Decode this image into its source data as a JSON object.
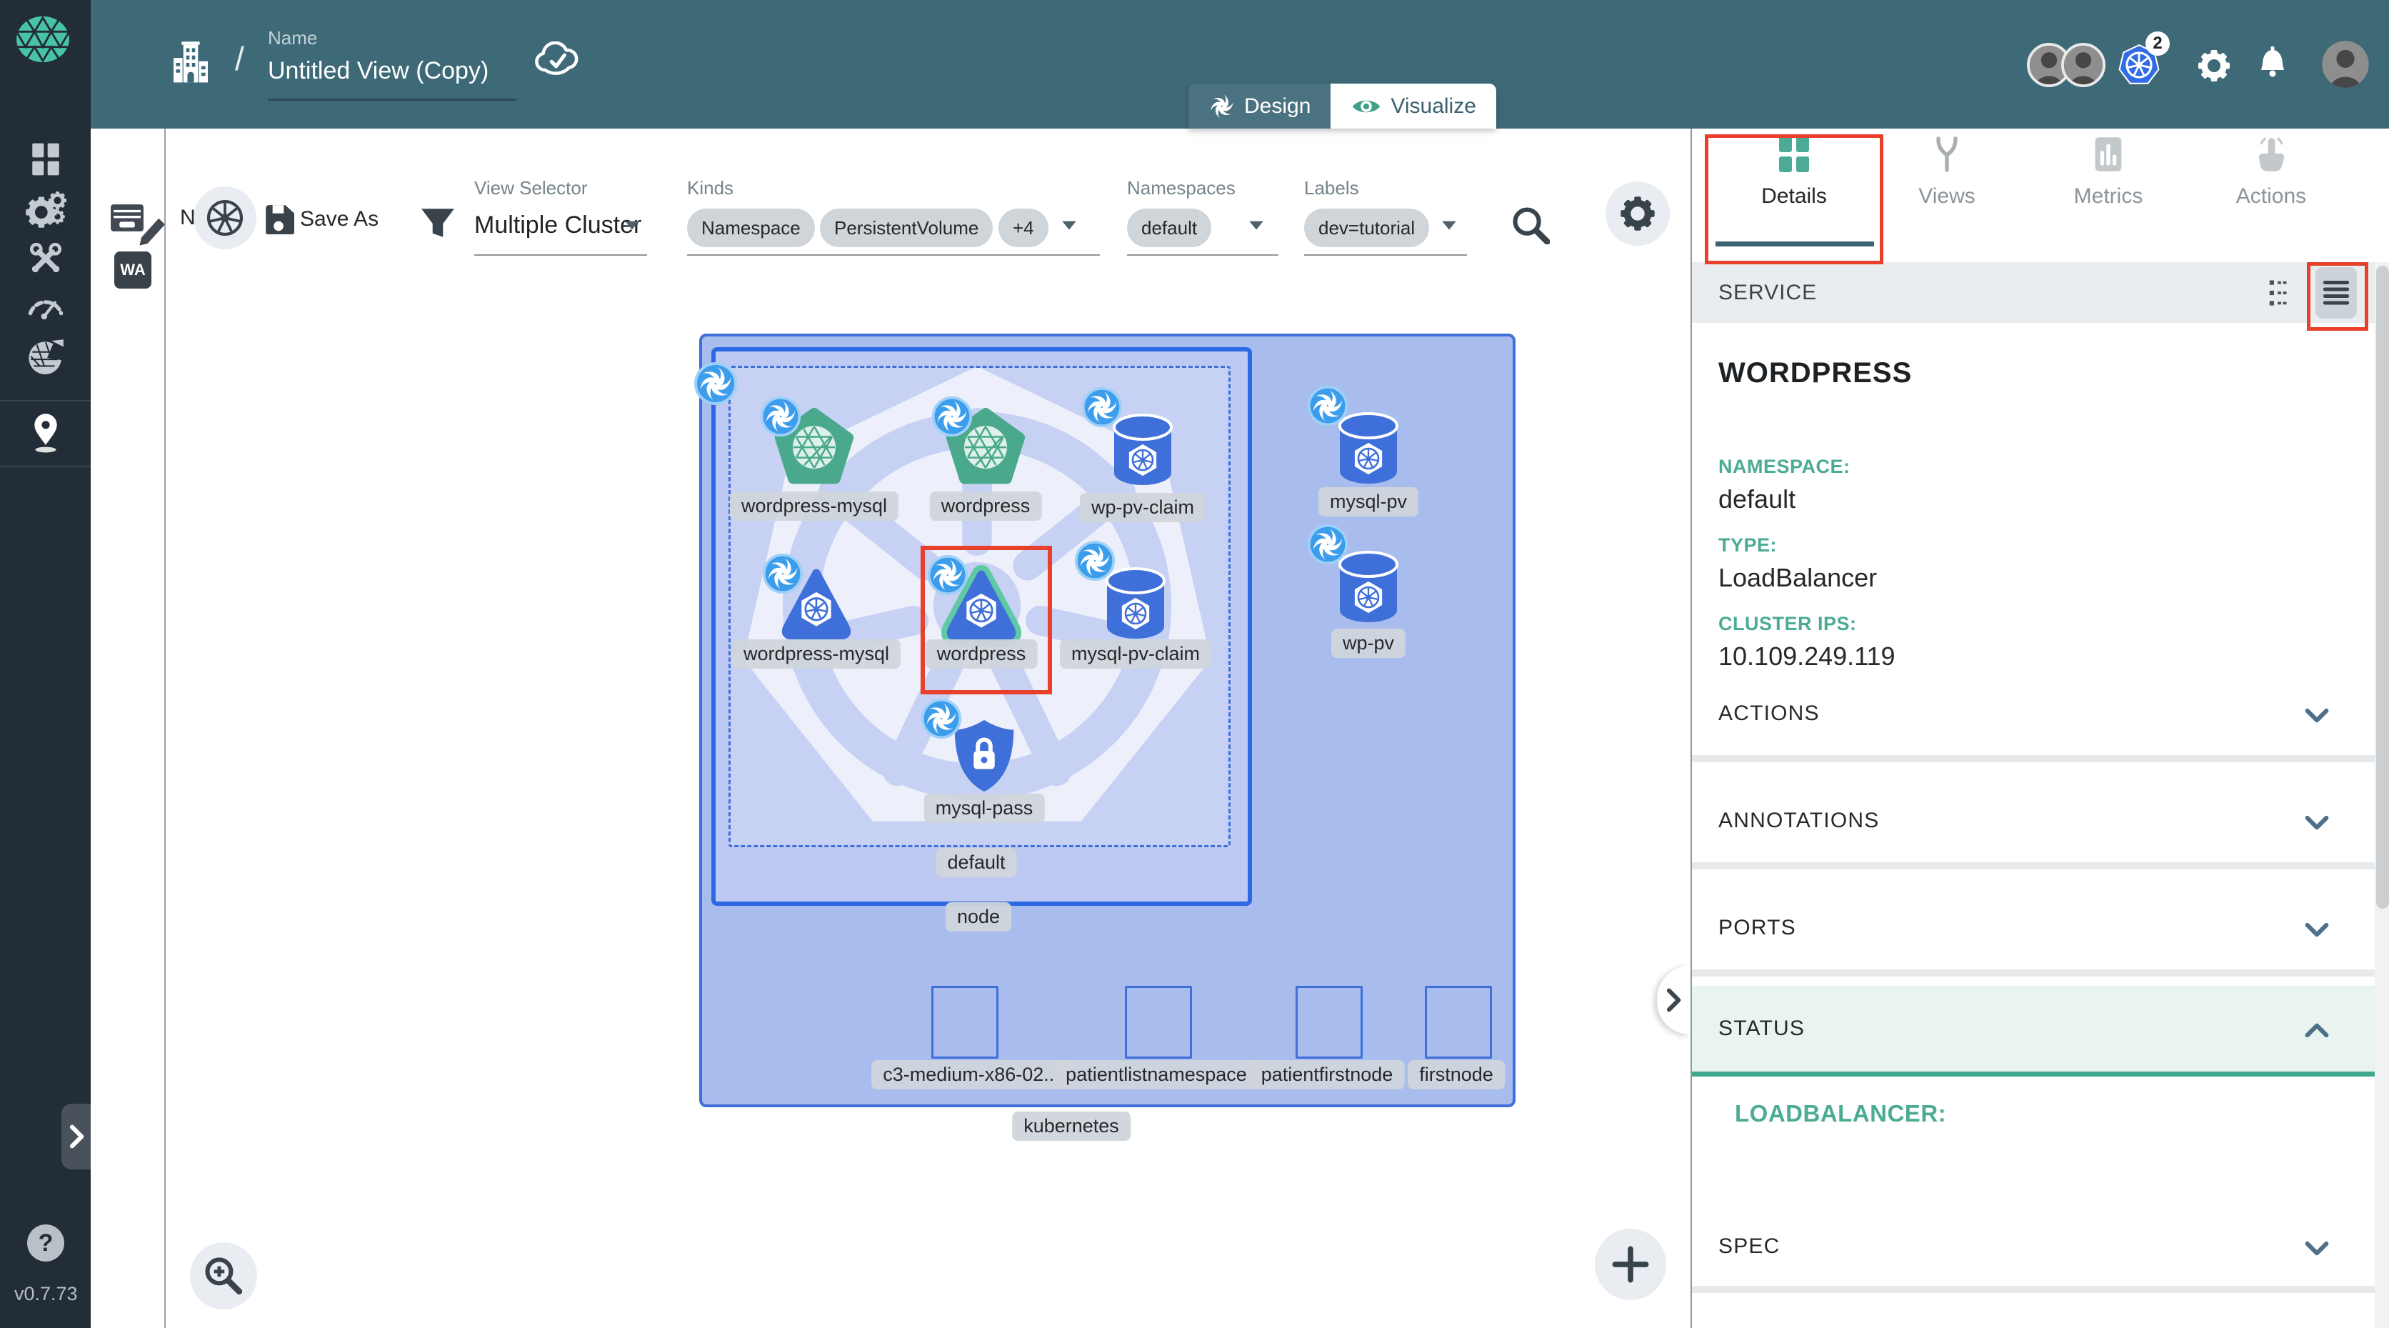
{
  "header": {
    "name_label": "Name",
    "name_value": "Untitled View (Copy)",
    "breadcrumb_separator": "/",
    "mode_design": "Design",
    "mode_visualize": "Visualize",
    "k8s_context_count": "2"
  },
  "sidebar": {
    "help_glyph": "?",
    "version": "v0.7.73"
  },
  "minibar": {
    "wa_label": "WA"
  },
  "toolbar": {
    "clipped_label": "N",
    "save_as": "Save As",
    "view_selector": {
      "label": "View Selector",
      "value": "Multiple Cluster"
    },
    "kinds": {
      "label": "Kinds",
      "chips": [
        "Namespace",
        "PersistentVolume",
        "+4"
      ]
    },
    "namespaces": {
      "label": "Namespaces",
      "value": "default"
    },
    "labels": {
      "label": "Labels",
      "value": "dev=tutorial"
    }
  },
  "canvas": {
    "cluster_label": "kubernetes",
    "node_box_label": "node",
    "namespace_box_label": "default",
    "resources": {
      "deployment_wordpress_mysql": "wordpress-mysql",
      "deployment_wordpress": "wordpress",
      "pvc_wp": "wp-pv-claim",
      "pvc_mysql": "mysql-pv-claim",
      "service_wordpress_mysql": "wordpress-mysql",
      "service_wordpress": "wordpress",
      "pv_mysql": "mysql-pv",
      "pv_wp": "wp-pv",
      "secret_mysql_pass": "mysql-pass"
    },
    "cluster_nodes": [
      "c3-medium-x86-02...",
      "patientlistnamespace",
      "patientfirstnode",
      "firstnode"
    ]
  },
  "panel": {
    "tabs": [
      {
        "label": "Details"
      },
      {
        "label": "Views"
      },
      {
        "label": "Metrics"
      },
      {
        "label": "Actions"
      }
    ],
    "resource_kind": "SERVICE",
    "title": "WORDPRESS",
    "fields": [
      {
        "label": "NAMESPACE:",
        "value": "default"
      },
      {
        "label": "TYPE:",
        "value": "LoadBalancer"
      },
      {
        "label": "CLUSTER IPS:",
        "value": "10.109.249.119"
      }
    ],
    "sections": [
      {
        "label": "ACTIONS"
      },
      {
        "label": "ANNOTATIONS"
      },
      {
        "label": "PORTS"
      }
    ],
    "status": {
      "label": "STATUS",
      "loadbalancer_label": "LOADBALANCER:"
    },
    "spec": {
      "label": "SPEC"
    }
  },
  "colors": {
    "header_teal": "#3e6a78",
    "accent_teal": "#4cab94",
    "k8s_blue": "#3f6fd8",
    "cluster_fill": "#a9bcee",
    "annotation_red": "#e8402a"
  }
}
